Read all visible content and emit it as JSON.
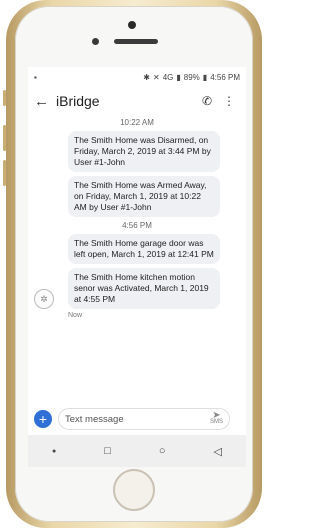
{
  "status": {
    "time": "4:56 PM",
    "battery": "89%",
    "network": "4G"
  },
  "appbar": {
    "title": "iBridge"
  },
  "messages": [
    {
      "type": "timestamp",
      "text": "10:22 AM"
    },
    {
      "type": "bubble",
      "text": "The Smith Home was Disarmed, on Friday, March 2, 2019 at 3:44 PM by User #1-John"
    },
    {
      "type": "bubble",
      "text": "The Smith Home was Armed Away, on Friday, March 1, 2019 at 10:22 AM by User #1-John"
    },
    {
      "type": "timestamp",
      "text": "4:56 PM"
    },
    {
      "type": "bubble",
      "text": "The Smith Home garage door was left open, March 1, 2019 at 12:41 PM"
    },
    {
      "type": "bubble",
      "text": "The Smith Home kitchen motion senor was Activated, March 1, 2019 at 4:55 PM"
    }
  ],
  "now_label": "Now",
  "compose": {
    "placeholder": "Text message",
    "send_label": "SMS"
  },
  "icons": {
    "back": "arrow-left-icon",
    "call": "phone-icon",
    "more": "more-vertical-icon",
    "add": "plus-icon",
    "send": "send-icon"
  }
}
